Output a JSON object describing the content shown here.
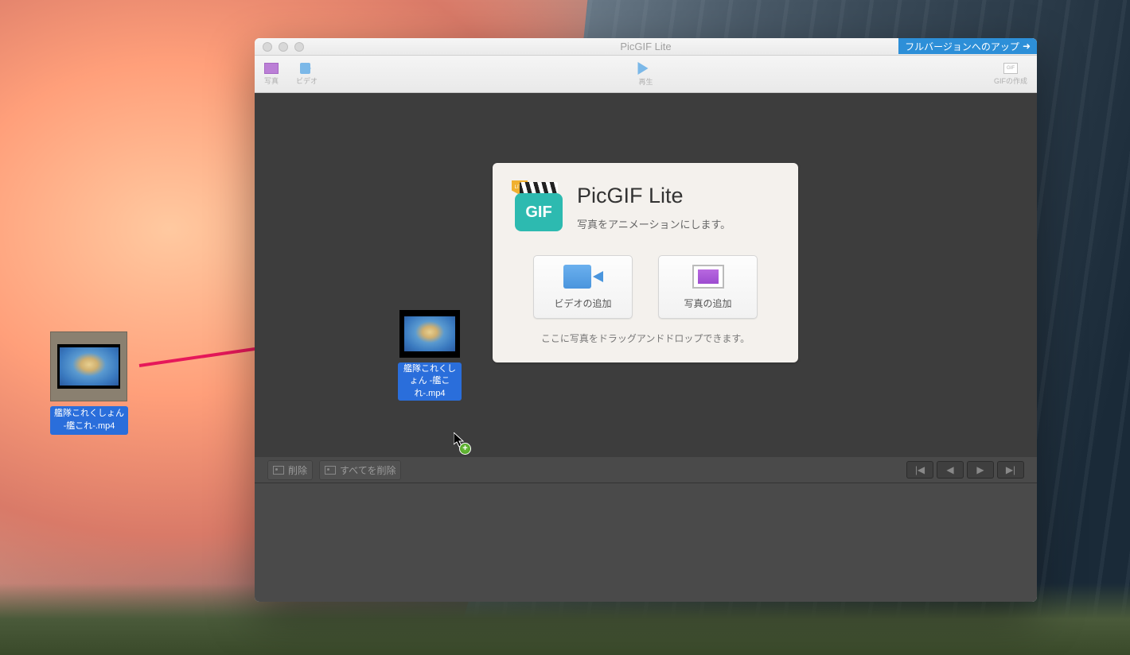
{
  "desktop": {
    "file_label": "艦隊これくしょん -艦これ-.mp4"
  },
  "window": {
    "title": "PicGIF Lite",
    "upgrade_label": "フルバージョンへのアップ",
    "toolbar": {
      "photo": "写真",
      "video": "ビデオ",
      "play": "再生",
      "gif": "GIFの作成",
      "gif_icon": "GIF"
    }
  },
  "welcome": {
    "title": "PicGIF Lite",
    "subtitle": "写真をアニメーションにします。",
    "icon_badge": "LITE",
    "icon_text": "GIF",
    "add_video": "ビデオの追加",
    "add_photo": "写真の追加",
    "drop_hint": "ここに写真をドラッグアンドドロップできます。"
  },
  "ghost": {
    "label": "艦隊これくしょん -艦これ-.mp4"
  },
  "toolstrip": {
    "delete": "削除",
    "delete_all": "すべてを削除"
  }
}
